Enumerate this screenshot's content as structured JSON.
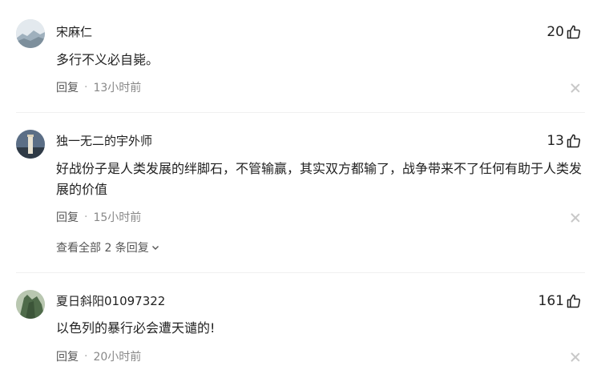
{
  "comments": [
    {
      "author": "宋麻仁",
      "likes": "20",
      "text": "多行不义必自毙。",
      "reply_label": "回复",
      "time": "13小时前"
    },
    {
      "author": "独一无二的宇外师",
      "likes": "13",
      "text": "好战份子是人类发展的绊脚石，不管输赢，其实双方都输了，战争带来不了任何有助于人类发展的价值",
      "reply_label": "回复",
      "time": "15小时前",
      "view_replies": "查看全部 2 条回复"
    },
    {
      "author": "夏日斜阳01097322",
      "likes": "161",
      "text": "以色列的暴行必会遭天谴的!",
      "reply_label": "回复",
      "time": "20小时前"
    }
  ],
  "separator": "·",
  "icons": {
    "like": "thumbs-up-icon",
    "close": "close-icon",
    "expand": "chevron-down-icon"
  }
}
